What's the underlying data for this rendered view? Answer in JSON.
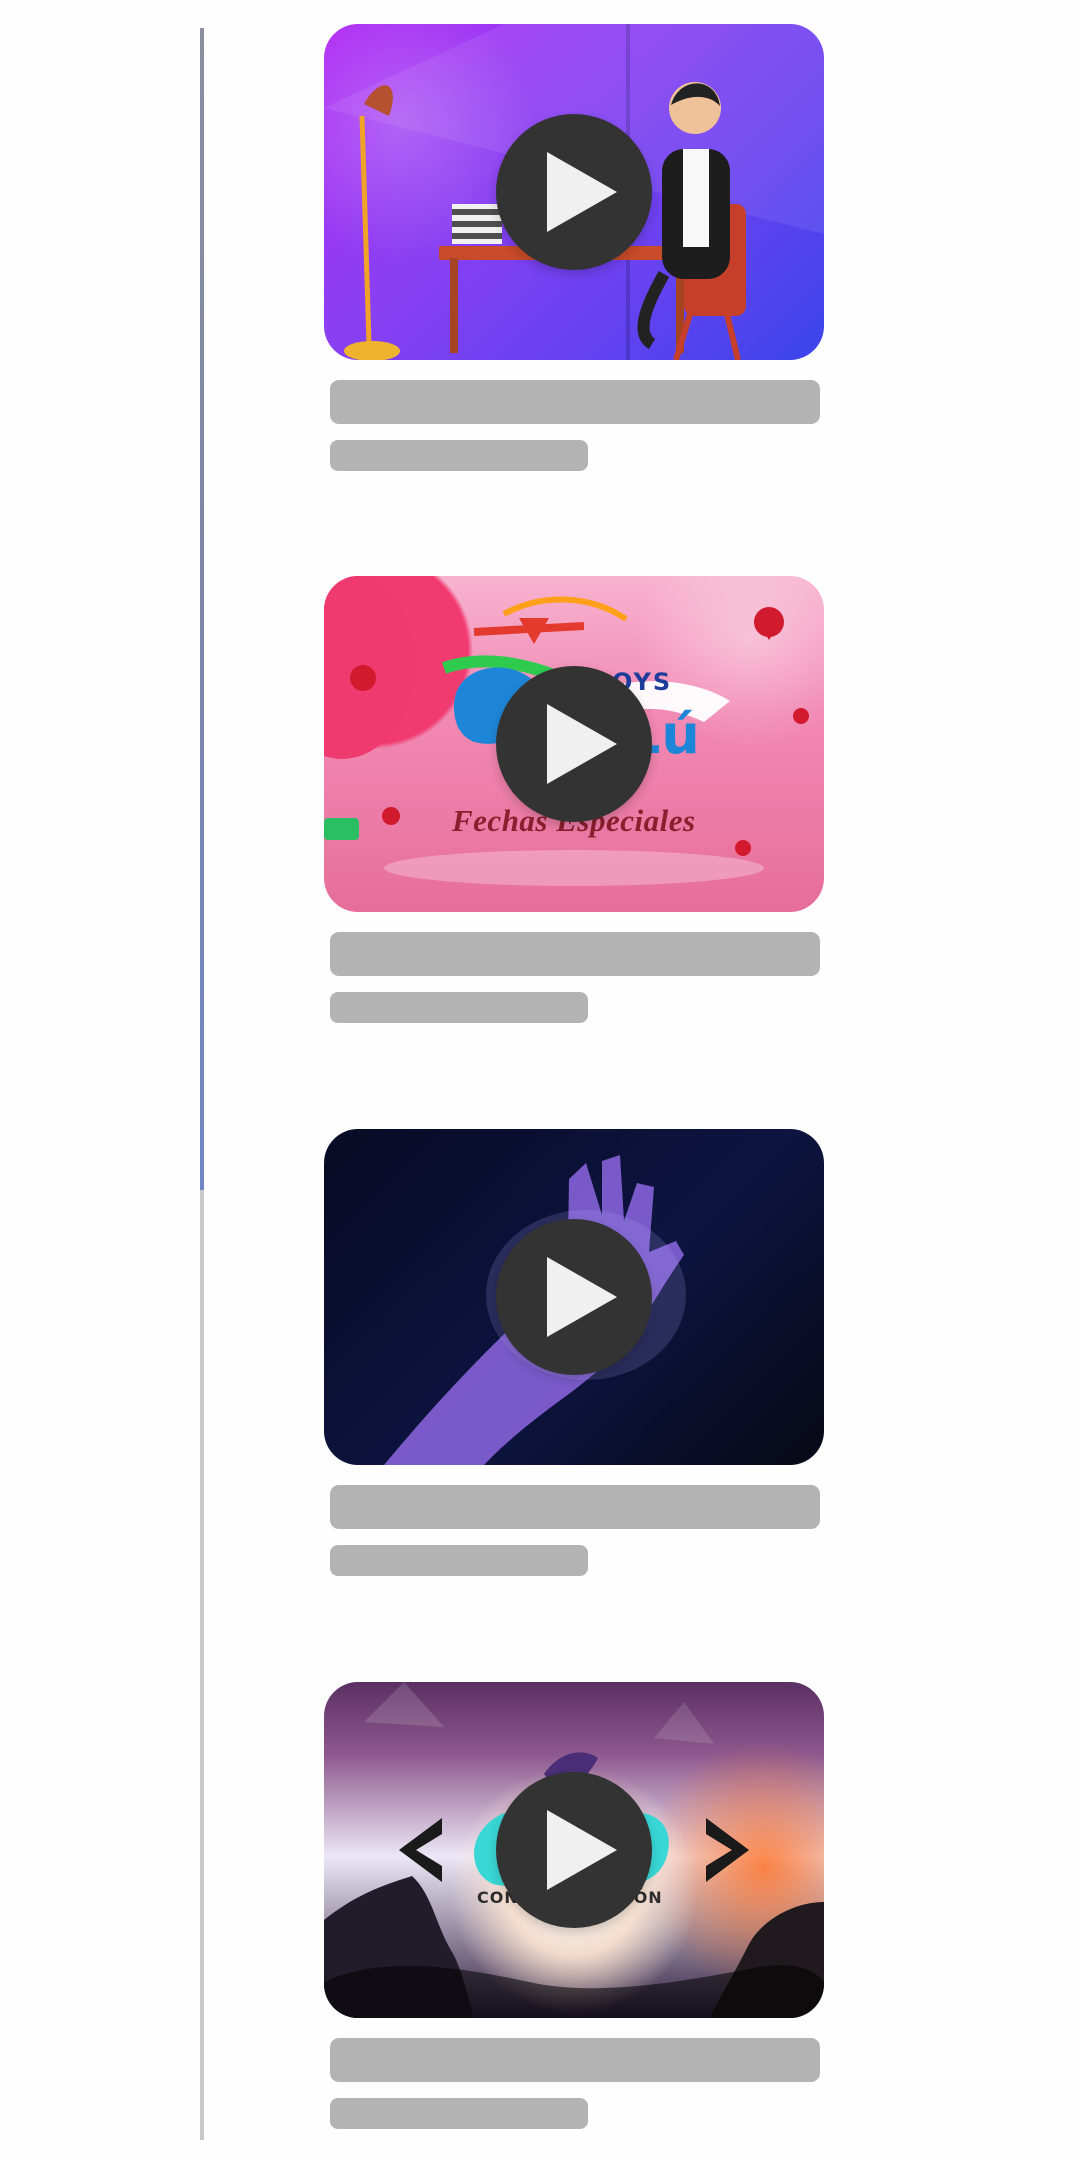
{
  "rail": {
    "progress_fraction": 0.55
  },
  "videos": [
    {
      "thumbnail_name": "office-animation-thumbnail",
      "overlay_text": "",
      "play_icon": "play-icon"
    },
    {
      "thumbnail_name": "fechas-especiales-thumbnail",
      "overlay_text": "Fechas Especiales",
      "banner_text": "OYS",
      "big_letters": "Lú",
      "play_icon": "play-icon"
    },
    {
      "thumbnail_name": "glowing-hand-thumbnail",
      "overlay_text": "",
      "play_icon": "play-icon"
    },
    {
      "thumbnail_name": "mountain-leap-thumbnail",
      "overlay_text": "CONV",
      "overlay_text_right": "CIÓN",
      "play_icon": "play-icon"
    }
  ],
  "colors": {
    "skeleton": "#b3b3b3",
    "play_button": "#333333",
    "play_triangle": "#f0f0f0",
    "rail": "#c9c9cc"
  }
}
